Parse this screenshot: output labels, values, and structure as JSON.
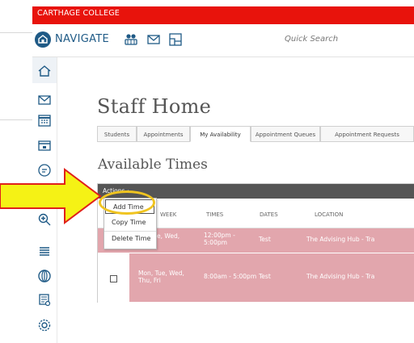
{
  "header": {
    "college": "CARTHAGE COLLEGE",
    "app_name": "NAVIGATE",
    "quick_search_placeholder": "Quick Search"
  },
  "colors": {
    "top_bar": "#e8130c",
    "brand": "#1f5a86",
    "actions_bar": "#555555",
    "row_bg": "#e2a6ad",
    "highlight": "#f0c420",
    "arrow_fill": "#f5f215",
    "arrow_stroke": "#e0201a"
  },
  "nav_icons": [
    "people-icon",
    "mail-icon",
    "chart-icon"
  ],
  "sidebar": [
    "home-icon",
    "mail-icon",
    "calendar-icon",
    "inbox-icon",
    "chat-icon",
    "zoom-in-icon",
    "list-icon",
    "globe-icon",
    "report-icon",
    "settings-icon"
  ],
  "main": {
    "title": "Staff Home",
    "tabs": [
      "Students",
      "Appointments",
      "My Availability",
      "Appointment Queues",
      "Appointment Requests"
    ],
    "active_tab": "My Availability",
    "section_title": "Available Times"
  },
  "grid": {
    "actions_label": "Actions ▴",
    "columns": [
      "WEEK",
      "TIMES",
      "DATES",
      "LOCATION"
    ],
    "rows": [
      {
        "days": "e, Wed,",
        "times": "12:00pm -\n5:00pm",
        "dates": "Test",
        "location": "The Advising Hub - Tra"
      },
      {
        "days": "Mon, Tue, Wed,\nThu, Fri",
        "times": "8:00am - 5:00pm",
        "dates": "Test",
        "location": "The Advising Hub - Tra"
      }
    ]
  },
  "actions_menu": {
    "items": [
      "Add Time",
      "Copy Time",
      "Delete Time"
    ],
    "selected": "Add Time"
  }
}
